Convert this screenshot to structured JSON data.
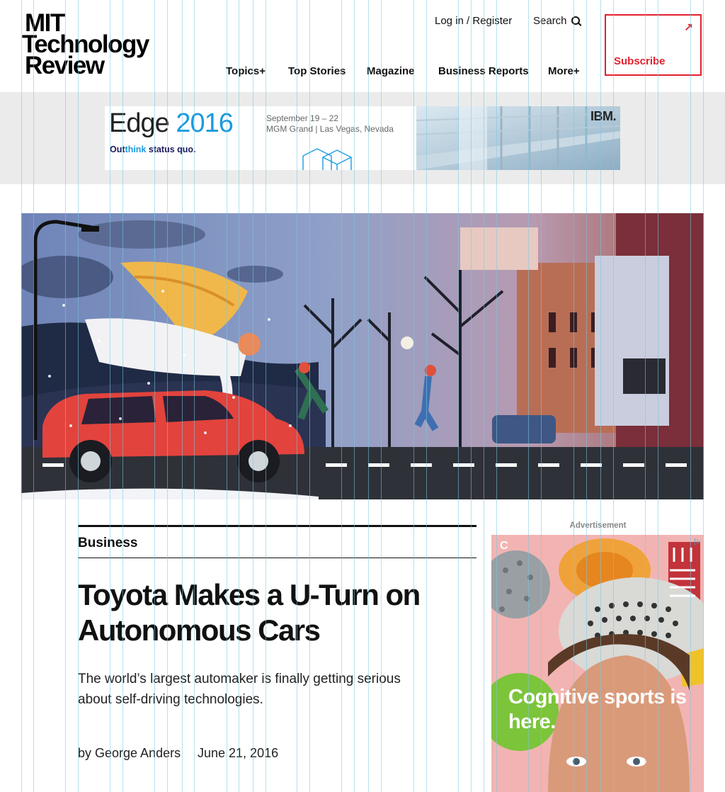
{
  "logo": {
    "line1": "MIT",
    "line2": "Technology",
    "line3": "Review"
  },
  "utility": {
    "login": "Log in / Register",
    "search": "Search"
  },
  "nav": [
    "Topics+",
    "Top Stories",
    "Magazine",
    "Business Reports",
    "More+"
  ],
  "subscribe": {
    "label": "Subscribe",
    "arrow": "↗"
  },
  "top_ad": {
    "edge": "Edge",
    "year": "2016",
    "tag_prefix": "Out",
    "tag_think": "think",
    "tag_suffix": " status quo.",
    "date": "September 19 – 22",
    "venue": "MGM Grand  |  Las Vegas, Nevada",
    "brand": "IBM."
  },
  "article": {
    "section": "Business",
    "headline": "Toyota Makes a U-Turn on Autonomous Cars",
    "dek": "The world’s largest automaker is finally getting serious about self-driving technologies.",
    "byline": "by George Anders",
    "date": "June 21, 2016"
  },
  "side_ad": {
    "label": "Advertisement",
    "headline": "Cognitive sports is here.",
    "corner": "C",
    "adchoice": "▷"
  },
  "colors": {
    "brand_red": "#e4202e",
    "edge_blue": "#1a9ae0",
    "ad_band": "#ebebeb",
    "side_ad_bg": "#f2b4b2"
  }
}
